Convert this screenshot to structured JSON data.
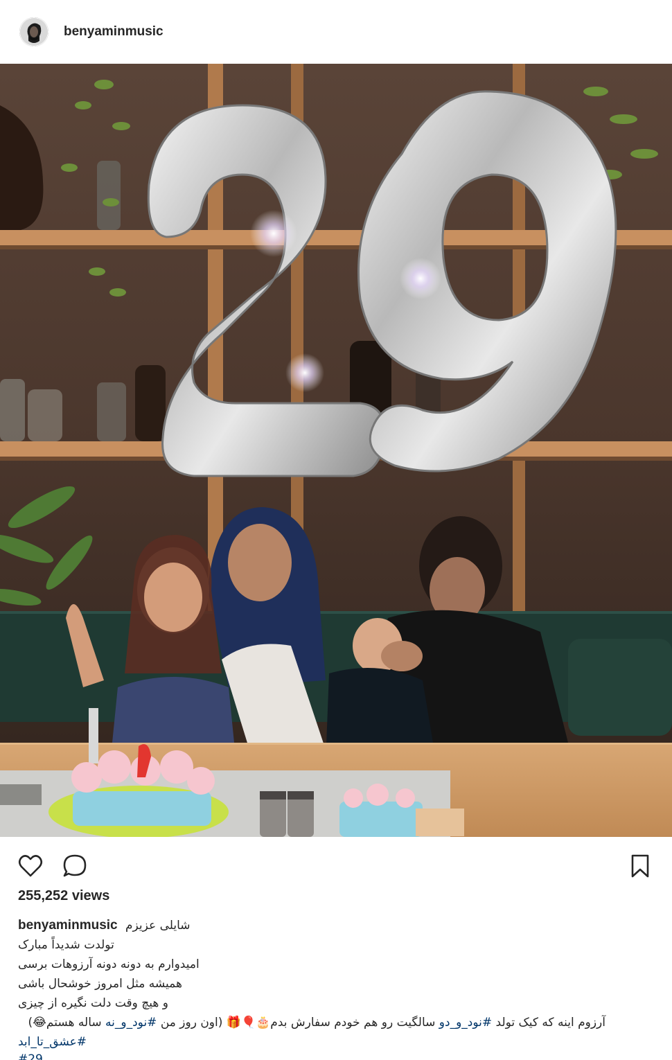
{
  "post": {
    "username": "benyaminmusic",
    "views": "255,252 views",
    "balloon_number": "29"
  },
  "caption": {
    "username": "benyaminmusic",
    "line1": "شایلی عزیزم",
    "line2": "تولدت شدیداً مبارک",
    "line3": "امیدوارم به دونه دونه آرزوهات برسی",
    "line4": "همیشه مثل امروز خوشحال باشی",
    "line5": "و هیچ وقت دلت نگیره از چیزی",
    "line6_a": "آرزوم اینه که کیک تولد",
    "line6_tag1": "#نود_و_دو",
    "line6_b": "سالگیت رو هم خودم سفارش بدم🎂🎈🎁",
    "line6_c": "(اون روز من",
    "line6_tag2": "#نود_و_نه",
    "line6_d": "ساله هستم😂)",
    "line7_tag": "#عشق_تا_ابد",
    "line8_tag": "#29"
  },
  "icons": {
    "like": "heart-icon",
    "comment": "comment-icon",
    "save": "bookmark-icon"
  }
}
